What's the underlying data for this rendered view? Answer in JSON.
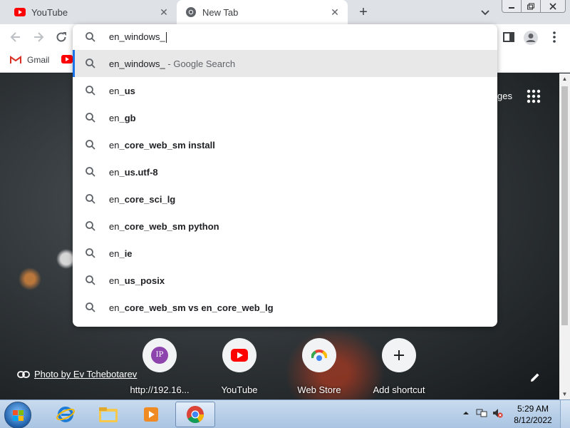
{
  "tabs": [
    {
      "title": "YouTube",
      "icon": "youtube-icon"
    },
    {
      "title": "New Tab",
      "icon": "chrome-icon"
    }
  ],
  "omnibox": {
    "value": "en_windows_",
    "suggestions": [
      {
        "query": "en_windows_",
        "suffix": " - Google Search",
        "prefix": "en_windows_",
        "bold": "",
        "selected": true
      },
      {
        "prefix": "en",
        "bold": "_us"
      },
      {
        "prefix": "en",
        "bold": "_gb"
      },
      {
        "prefix": "en",
        "bold": "_core_web_sm install"
      },
      {
        "prefix": "en",
        "bold": "_us.utf-8"
      },
      {
        "prefix": "en",
        "bold": "_core_sci_lg"
      },
      {
        "prefix": "en",
        "bold": "_core_web_sm python"
      },
      {
        "prefix": "en",
        "bold": "_ie"
      },
      {
        "prefix": "en",
        "bold": "_us_posix"
      },
      {
        "prefix": "en",
        "bold": "_core_web_sm vs en_core_web_lg"
      }
    ]
  },
  "bookmarks": [
    {
      "label": "Gmail",
      "icon": "gmail-icon"
    }
  ],
  "ntp": {
    "images_label": "ges",
    "photo_credit": "Photo by Ev Tchebotarev",
    "shortcuts": [
      {
        "label": "http://192.16...",
        "icon": "ip-icon",
        "icon_text": "IP"
      },
      {
        "label": "YouTube",
        "icon": "youtube-icon"
      },
      {
        "label": "Web Store",
        "icon": "web-store-icon"
      },
      {
        "label": "Add shortcut",
        "icon": "plus-icon"
      }
    ]
  },
  "taskbar": {
    "time": "5:29 AM",
    "date": "8/12/2022"
  },
  "colors": {
    "accent": "#1a73e8",
    "youtube_red": "#ff0000",
    "selected_row": "#e8e8e9"
  }
}
